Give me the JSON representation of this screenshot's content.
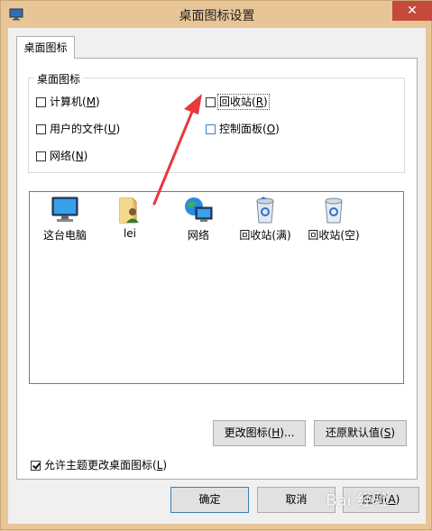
{
  "window": {
    "title": "桌面图标设置",
    "close_glyph": "✕"
  },
  "tab": {
    "label": "桌面图标"
  },
  "group": {
    "title": "桌面图标",
    "computer": {
      "pre": "计算机(",
      "key": "M",
      "post": ")",
      "checked": false
    },
    "recycle": {
      "pre": "回收站(",
      "key": "R",
      "post": ")",
      "checked": false
    },
    "userfiles": {
      "pre": "用户的文件(",
      "key": "U",
      "post": ")",
      "checked": false
    },
    "control": {
      "pre": "控制面板(",
      "key": "O",
      "post": ")",
      "checked": false
    },
    "network": {
      "pre": "网络(",
      "key": "N",
      "post": ")",
      "checked": false
    }
  },
  "icons": [
    {
      "label": "这台电脑",
      "icon": "computer-icon"
    },
    {
      "label": "lei",
      "icon": "user-folder-icon"
    },
    {
      "label": "网络",
      "icon": "network-icon"
    },
    {
      "label": "回收站(满)",
      "icon": "recycle-bin-full-icon"
    },
    {
      "label": "回收站(空)",
      "icon": "recycle-bin-empty-icon"
    }
  ],
  "buttons": {
    "change_icon": {
      "pre": "更改图标(",
      "key": "H",
      "post": ")..."
    },
    "restore_default": {
      "pre": "还原默认值(",
      "key": "S",
      "post": ")"
    },
    "ok": "确定",
    "cancel": "取消",
    "apply": {
      "pre": "应用(",
      "key": "A",
      "post": ")"
    }
  },
  "allow_themes": {
    "pre": "允许主题更改桌面图标(",
    "key": "L",
    "post": ")",
    "checked": true
  },
  "watermark": "Bai 经验",
  "colors": {
    "accent_border": "#3c7fb1",
    "arrow": "#e8383d",
    "window_frame": "#e8c596"
  }
}
